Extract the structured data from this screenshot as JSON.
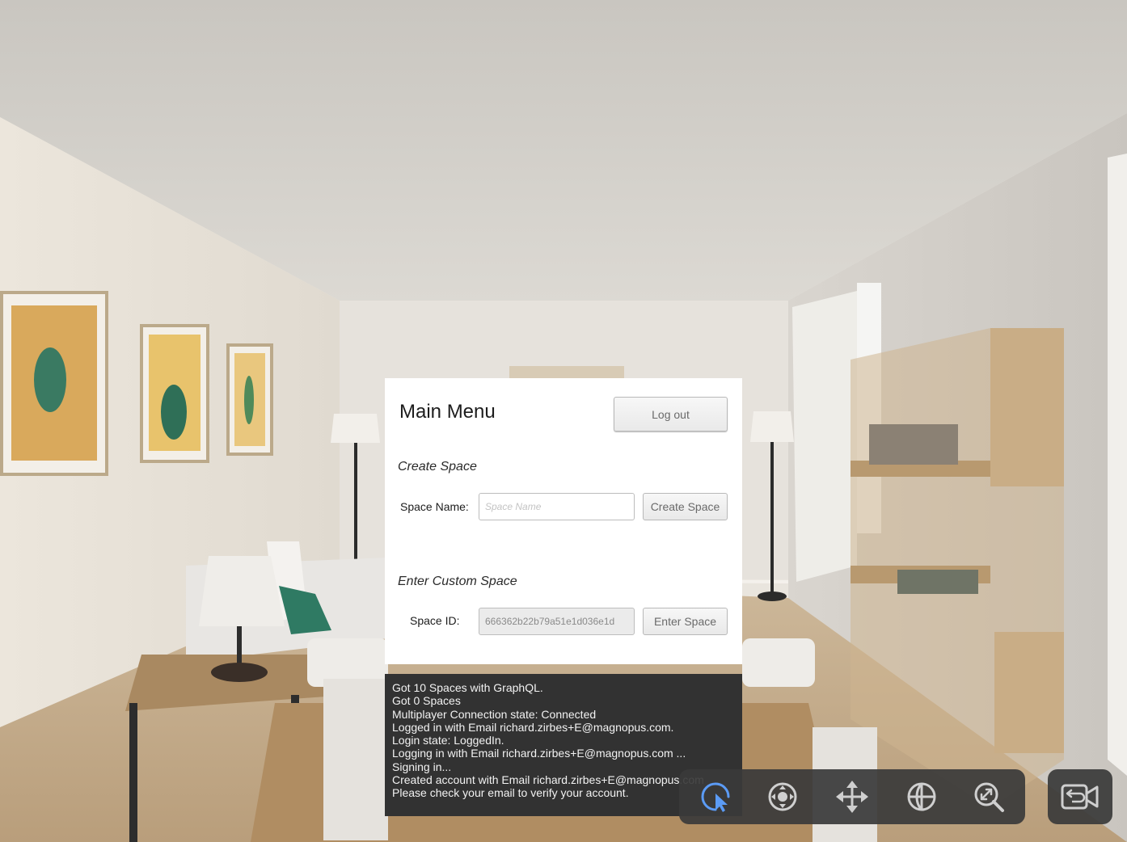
{
  "menu": {
    "title": "Main Menu",
    "logout_label": "Log out",
    "create_section": {
      "heading": "Create Space",
      "label": "Space Name:",
      "placeholder": "Space Name",
      "button": "Create Space"
    },
    "enter_section": {
      "heading": "Enter Custom Space",
      "label": "Space ID:",
      "value": "666362b22b79a51e1d036e1d",
      "button": "Enter Space"
    }
  },
  "console": {
    "lines": [
      "Got 10 Spaces with GraphQL.",
      "Got 0 Spaces",
      "Multiplayer Connection state: Connected",
      "Logged in with Email richard.zirbes+E@magnopus.com.",
      "Login state: LoggedIn.",
      "Logging in with Email richard.zirbes+E@magnopus.com ...",
      "Signing in...",
      "Created account with Email richard.zirbes+E@magnopus.com",
      "Please check your email to verify your account."
    ]
  },
  "toolbar": {
    "tools": [
      {
        "icon": "select-pointer-icon",
        "active": true
      },
      {
        "icon": "orbit-icon",
        "active": false
      },
      {
        "icon": "move-icon",
        "active": false
      },
      {
        "icon": "globe-icon",
        "active": false
      },
      {
        "icon": "zoom-icon",
        "active": false
      }
    ],
    "camera_icon": "camera-switch-icon"
  },
  "colors": {
    "active_tool": "#5b9bf5",
    "inactive_tool": "#cfcfcf",
    "console_bg": "#323232",
    "panel_bg": "#ffffff"
  }
}
